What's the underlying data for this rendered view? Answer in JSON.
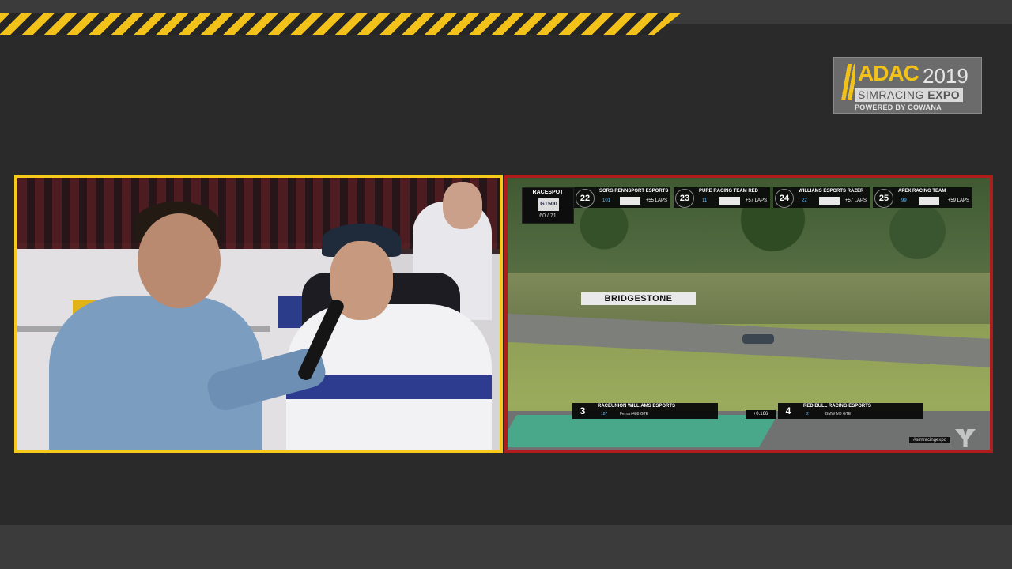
{
  "logo": {
    "brand": "ADAC",
    "year": "2019",
    "sub_line_1": "SIMRACING",
    "sub_line_2": "EXPO",
    "powered": "POWERED BY COWANA"
  },
  "game": {
    "trackside_banner": "BRIDGESTONE",
    "broadcast": {
      "brand": "RACESPOT",
      "series": "GT500",
      "lap": "60 / 71"
    },
    "tower": [
      {
        "pos": "22",
        "team": "SORG RENNSPORT ESPORTS",
        "num": "101",
        "gap": "+55 LAPS"
      },
      {
        "pos": "23",
        "team": "PURE RACING TEAM RED",
        "num": "11",
        "gap": "+57 LAPS"
      },
      {
        "pos": "24",
        "team": "WILLIAMS ESPORTS RAZER",
        "num": "22",
        "gap": "+57 LAPS"
      },
      {
        "pos": "25",
        "team": "APEX RACING TEAM",
        "num": "99",
        "gap": "+59 LAPS"
      }
    ],
    "battle": {
      "left": {
        "pos": "3",
        "team": "RACEUNION WILLIAMS ESPORTS",
        "num": "187",
        "model": "Ferrari 488 GTE"
      },
      "interval": "+0.166",
      "right": {
        "pos": "4",
        "team": "RED BULL RACING ESPORTS",
        "num": "2",
        "model": "BMW M8 GTE"
      }
    },
    "hashtag": "#simracingexpo"
  },
  "colors": {
    "hazard_yellow": "#f2c21b",
    "camera_border": "#f6c91a",
    "game_border": "#b01c1c"
  }
}
